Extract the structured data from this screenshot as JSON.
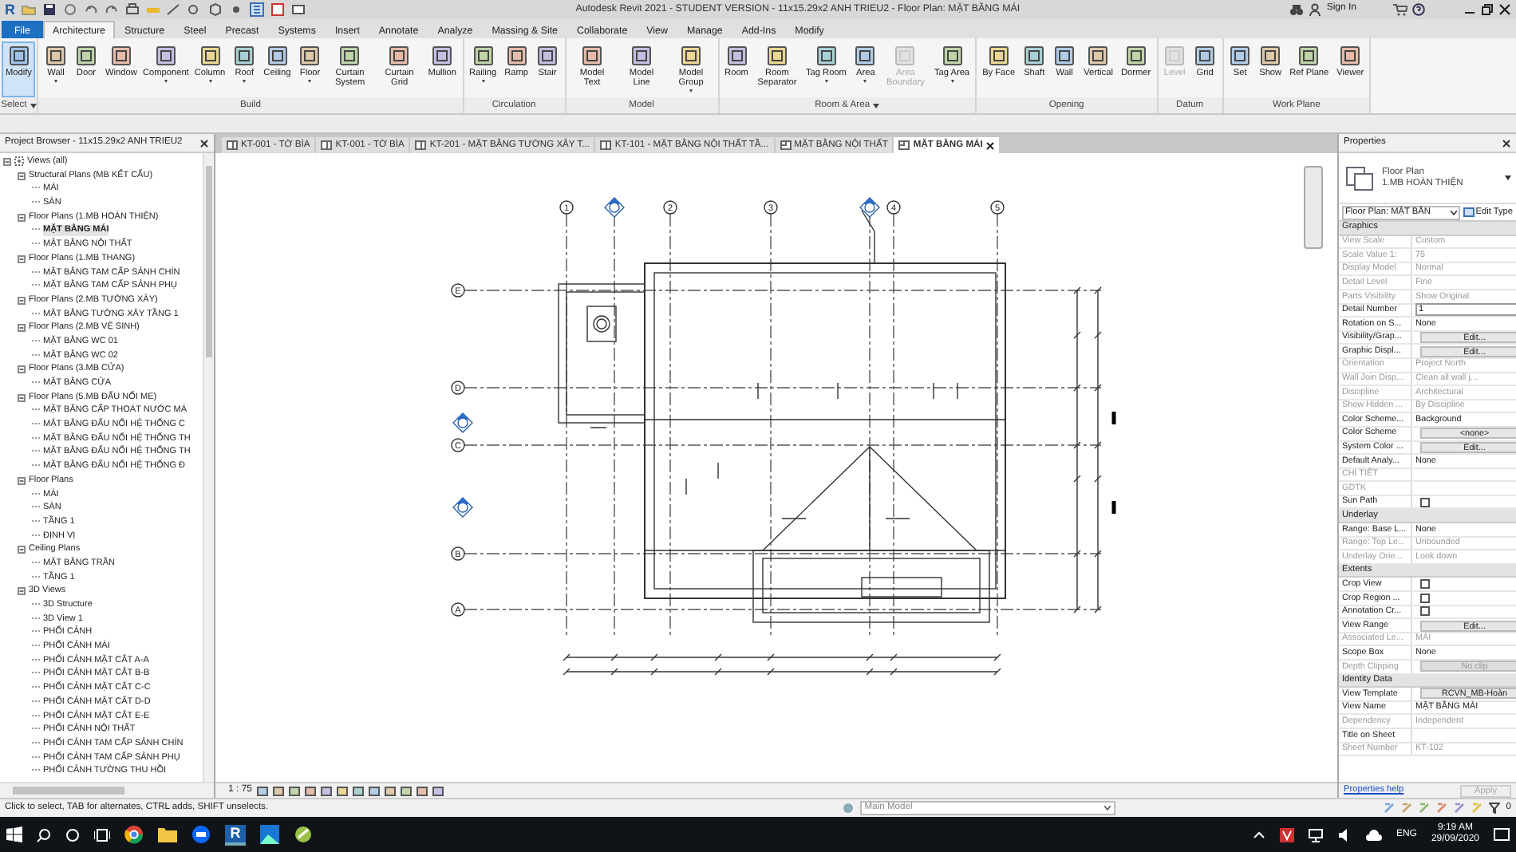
{
  "title_bar": {
    "app_logo": "R",
    "title": "Autodesk Revit 2021 - STUDENT VERSION - 11x15.29x2 ANH TRIEU2 - Floor Plan: MẶT BẰNG MÁI",
    "sign_in": "Sign In"
  },
  "ribbon_tabs": [
    {
      "label": "File",
      "kind": "file",
      "selected": false
    },
    {
      "label": "Architecture",
      "kind": "tab",
      "selected": true
    },
    {
      "label": "Structure",
      "kind": "tab",
      "selected": false
    },
    {
      "label": "Steel",
      "kind": "tab",
      "selected": false
    },
    {
      "label": "Precast",
      "kind": "tab",
      "selected": false
    },
    {
      "label": "Systems",
      "kind": "tab",
      "selected": false
    },
    {
      "label": "Insert",
      "kind": "tab",
      "selected": false
    },
    {
      "label": "Annotate",
      "kind": "tab",
      "selected": false
    },
    {
      "label": "Analyze",
      "kind": "tab",
      "selected": false
    },
    {
      "label": "Massing & Site",
      "kind": "tab",
      "selected": false
    },
    {
      "label": "Collaborate",
      "kind": "tab",
      "selected": false
    },
    {
      "label": "View",
      "kind": "tab",
      "selected": false
    },
    {
      "label": "Manage",
      "kind": "tab",
      "selected": false
    },
    {
      "label": "Add-Ins",
      "kind": "tab",
      "selected": false
    },
    {
      "label": "Modify",
      "kind": "tab",
      "selected": false
    }
  ],
  "ribbon_panels": [
    {
      "label": "Select",
      "has_menu": true,
      "tools": [
        {
          "label": "Modify",
          "selected": true,
          "disabled": false,
          "dropdown": false
        }
      ]
    },
    {
      "label": "Build",
      "has_menu": false,
      "tools": [
        {
          "label": "Wall",
          "selected": false,
          "disabled": false,
          "dropdown": true
        },
        {
          "label": "Door",
          "selected": false,
          "disabled": false,
          "dropdown": false
        },
        {
          "label": "Window",
          "selected": false,
          "disabled": false,
          "dropdown": false
        },
        {
          "label": "Component",
          "selected": false,
          "disabled": false,
          "dropdown": true
        },
        {
          "label": "Column",
          "selected": false,
          "disabled": false,
          "dropdown": true
        },
        {
          "label": "Roof",
          "selected": false,
          "disabled": false,
          "dropdown": true
        },
        {
          "label": "Ceiling",
          "selected": false,
          "disabled": false,
          "dropdown": false
        },
        {
          "label": "Floor",
          "selected": false,
          "disabled": false,
          "dropdown": true
        },
        {
          "label": "Curtain System",
          "selected": false,
          "disabled": false,
          "dropdown": false
        },
        {
          "label": "Curtain Grid",
          "selected": false,
          "disabled": false,
          "dropdown": false
        },
        {
          "label": "Mullion",
          "selected": false,
          "disabled": false,
          "dropdown": false
        }
      ]
    },
    {
      "label": "Circulation",
      "has_menu": false,
      "tools": [
        {
          "label": "Railing",
          "selected": false,
          "disabled": false,
          "dropdown": true
        },
        {
          "label": "Ramp",
          "selected": false,
          "disabled": false,
          "dropdown": false
        },
        {
          "label": "Stair",
          "selected": false,
          "disabled": false,
          "dropdown": false
        }
      ]
    },
    {
      "label": "Model",
      "has_menu": false,
      "tools": [
        {
          "label": "Model Text",
          "selected": false,
          "disabled": false,
          "dropdown": false
        },
        {
          "label": "Model Line",
          "selected": false,
          "disabled": false,
          "dropdown": false
        },
        {
          "label": "Model Group",
          "selected": false,
          "disabled": false,
          "dropdown": true
        }
      ]
    },
    {
      "label": "Room & Area",
      "has_menu": true,
      "tools": [
        {
          "label": "Room",
          "selected": false,
          "disabled": false,
          "dropdown": false
        },
        {
          "label": "Room Separator",
          "selected": false,
          "disabled": false,
          "dropdown": false
        },
        {
          "label": "Tag Room",
          "selected": false,
          "disabled": false,
          "dropdown": true
        },
        {
          "label": "Area",
          "selected": false,
          "disabled": false,
          "dropdown": true
        },
        {
          "label": "Area Boundary",
          "selected": false,
          "disabled": true,
          "dropdown": false
        },
        {
          "label": "Tag Area",
          "selected": false,
          "disabled": false,
          "dropdown": true
        }
      ]
    },
    {
      "label": "Opening",
      "has_menu": false,
      "tools": [
        {
          "label": "By Face",
          "selected": false,
          "disabled": false,
          "dropdown": false
        },
        {
          "label": "Shaft",
          "selected": false,
          "disabled": false,
          "dropdown": false
        },
        {
          "label": "Wall",
          "selected": false,
          "disabled": false,
          "dropdown": false
        },
        {
          "label": "Vertical",
          "selected": false,
          "disabled": false,
          "dropdown": false
        },
        {
          "label": "Dormer",
          "selected": false,
          "disabled": false,
          "dropdown": false
        }
      ]
    },
    {
      "label": "Datum",
      "has_menu": false,
      "tools": [
        {
          "label": "Level",
          "selected": false,
          "disabled": true,
          "dropdown": false
        },
        {
          "label": "Grid",
          "selected": false,
          "disabled": false,
          "dropdown": false
        }
      ]
    },
    {
      "label": "Work Plane",
      "has_menu": false,
      "tools": [
        {
          "label": "Set",
          "selected": false,
          "disabled": false,
          "dropdown": false
        },
        {
          "label": "Show",
          "selected": false,
          "disabled": false,
          "dropdown": false
        },
        {
          "label": "Ref Plane",
          "selected": false,
          "disabled": false,
          "dropdown": false
        },
        {
          "label": "Viewer",
          "selected": false,
          "disabled": false,
          "dropdown": false
        }
      ]
    }
  ],
  "project_browser": {
    "title": "Project Browser - 11x15.29x2 ANH TRIEU2",
    "tree": [
      {
        "label": "Views (all)",
        "selected": false,
        "expanded": true,
        "children": [
          {
            "label": "Structural Plans (MB KẾT CẤU)",
            "selected": false,
            "expanded": true,
            "children": [
              {
                "label": "MÁI",
                "selected": false
              },
              {
                "label": "SÀN",
                "selected": false
              }
            ]
          },
          {
            "label": "Floor Plans (1.MB HOÀN THIỆN)",
            "selected": false,
            "expanded": true,
            "children": [
              {
                "label": "MẶT BẰNG MÁI",
                "selected": true
              },
              {
                "label": "MẶT BẰNG NỘI THẤT",
                "selected": false
              }
            ]
          },
          {
            "label": "Floor Plans (1.MB THANG)",
            "selected": false,
            "expanded": true,
            "children": [
              {
                "label": "MẶT BẰNG TAM CẤP SẢNH CHÍN",
                "selected": false
              },
              {
                "label": "MẶT BẰNG TAM CẤP SẢNH PHỤ",
                "selected": false
              }
            ]
          },
          {
            "label": "Floor Plans (2.MB TƯỜNG XÂY)",
            "selected": false,
            "expanded": true,
            "children": [
              {
                "label": "MẶT BẰNG TƯỜNG XÂY TẦNG 1",
                "selected": false
              }
            ]
          },
          {
            "label": "Floor Plans (2.MB VỆ SINH)",
            "selected": false,
            "expanded": true,
            "children": [
              {
                "label": "MẶT BẰNG WC 01",
                "selected": false
              },
              {
                "label": "MẶT BẰNG WC 02",
                "selected": false
              }
            ]
          },
          {
            "label": "Floor Plans (3.MB CỬA)",
            "selected": false,
            "expanded": true,
            "children": [
              {
                "label": "MẶT BẰNG CỬA",
                "selected": false
              }
            ]
          },
          {
            "label": "Floor Plans (5.MB ĐẤU NỐI ME)",
            "selected": false,
            "expanded": true,
            "children": [
              {
                "label": "MẶT BẰNG CẤP THOÁT NƯỚC MÁ",
                "selected": false
              },
              {
                "label": "MẶT BẰNG ĐẤU NỐI HỆ THỐNG C",
                "selected": false
              },
              {
                "label": "MẶT BẰNG ĐẤU NỐI HỆ THỐNG TH",
                "selected": false
              },
              {
                "label": "MẶT BẰNG ĐẤU NỐI HỆ THỐNG TH",
                "selected": false
              },
              {
                "label": "MẶT BẰNG ĐẤU NỐI HỆ THỐNG Đ",
                "selected": false
              }
            ]
          },
          {
            "label": "Floor Plans",
            "selected": false,
            "expanded": true,
            "children": [
              {
                "label": "MÁI",
                "selected": false
              },
              {
                "label": "SÀN",
                "selected": false
              },
              {
                "label": "TẦNG 1",
                "selected": false
              },
              {
                "label": "ĐỊNH VỊ",
                "selected": false
              }
            ]
          },
          {
            "label": "Ceiling Plans",
            "selected": false,
            "expanded": true,
            "children": [
              {
                "label": "MẶT BẰNG TRẦN",
                "selected": false
              },
              {
                "label": "TẦNG 1",
                "selected": false
              }
            ]
          },
          {
            "label": "3D Views",
            "selected": false,
            "expanded": true,
            "children": [
              {
                "label": "3D Structure",
                "selected": false
              },
              {
                "label": "3D View 1",
                "selected": false
              },
              {
                "label": "PHỐI CẢNH",
                "selected": false
              },
              {
                "label": "PHỐI CẢNH MÁI",
                "selected": false
              },
              {
                "label": "PHỐI CẢNH MẶT CẮT A-A",
                "selected": false
              },
              {
                "label": "PHỐI CẢNH MẶT CẮT B-B",
                "selected": false
              },
              {
                "label": "PHỐI CẢNH MẶT CẮT C-C",
                "selected": false
              },
              {
                "label": "PHỐI CẢNH MẶT CẮT D-D",
                "selected": false
              },
              {
                "label": "PHỐI CẢNH MẶT CẮT E-E",
                "selected": false
              },
              {
                "label": "PHỐI CẢNH NỘI THẤT",
                "selected": false
              },
              {
                "label": "PHỐI CẢNH TAM CẤP SẢNH CHÍN",
                "selected": false
              },
              {
                "label": "PHỐI CẢNH TAM CẤP SẢNH PHỤ",
                "selected": false
              },
              {
                "label": "PHỐI CẢNH TƯỜNG THU HỒI",
                "selected": false
              }
            ]
          }
        ]
      }
    ]
  },
  "view_tabs": [
    {
      "label": "KT-001 - TỜ BÌA",
      "kind": "sheet",
      "selected": false
    },
    {
      "label": "KT-001 - TỜ BÌA",
      "kind": "sheet",
      "selected": false
    },
    {
      "label": "KT-201 - MẶT BẰNG TƯỜNG XÂY T...",
      "kind": "sheet",
      "selected": false
    },
    {
      "label": "KT-101 - MẶT BẰNG NỘI THẤT TẦ...",
      "kind": "sheet",
      "selected": false
    },
    {
      "label": "MẶT BẰNG NỘI THẤT",
      "kind": "plan",
      "selected": false
    },
    {
      "label": "MẶT BẰNG MÁI",
      "kind": "plan",
      "selected": true
    }
  ],
  "drawing": {
    "column_grids": [
      "1",
      "2",
      "3",
      "4",
      "5"
    ],
    "row_grids": [
      "E",
      "D",
      "C",
      "B",
      "A"
    ]
  },
  "view_bar": {
    "scale": "1 : 75"
  },
  "properties": {
    "title": "Properties",
    "type_family": "Floor Plan",
    "type_name": "1.MB HOÀN THIỆN",
    "instance_selector": "Floor Plan: MẶT BẰN",
    "edit_type": "Edit Type",
    "groups": [
      {
        "label": "Graphics",
        "rows": [
          {
            "name": "View Scale",
            "value": "Custom",
            "kind": "text",
            "disabled": true
          },
          {
            "name": "Scale Value    1:",
            "value": "75",
            "kind": "text",
            "disabled": true
          },
          {
            "name": "Display Model",
            "value": "Normal",
            "kind": "text",
            "disabled": true
          },
          {
            "name": "Detail Level",
            "value": "Fine",
            "kind": "text",
            "disabled": true
          },
          {
            "name": "Parts Visibility",
            "value": "Show Original",
            "kind": "text",
            "disabled": true
          },
          {
            "name": "Detail Number",
            "value": "1",
            "kind": "input",
            "disabled": false
          },
          {
            "name": "Rotation on S...",
            "value": "None",
            "kind": "text",
            "disabled": false
          },
          {
            "name": "Visibility/Grap...",
            "value": "Edit...",
            "kind": "button",
            "disabled": false
          },
          {
            "name": "Graphic Displ...",
            "value": "Edit...",
            "kind": "button",
            "disabled": false
          },
          {
            "name": "Orientation",
            "value": "Project North",
            "kind": "text",
            "disabled": true
          },
          {
            "name": "Wall Join Disp...",
            "value": "Clean all wall j...",
            "kind": "text",
            "disabled": true
          },
          {
            "name": "Discipline",
            "value": "Architectural",
            "kind": "text",
            "disabled": true
          },
          {
            "name": "Show Hidden ...",
            "value": "By Discipline",
            "kind": "text",
            "disabled": true
          },
          {
            "name": "Color Scheme...",
            "value": "Background",
            "kind": "text",
            "disabled": false
          },
          {
            "name": "Color Scheme",
            "value": "<none>",
            "kind": "button",
            "disabled": false
          },
          {
            "name": "System Color ...",
            "value": "Edit...",
            "kind": "button",
            "disabled": false
          },
          {
            "name": "Default Analy...",
            "value": "None",
            "kind": "text",
            "disabled": false
          },
          {
            "name": "CHI TIẾT",
            "kind": "text",
            "disabled": true
          },
          {
            "name": "GDTK",
            "kind": "text",
            "disabled": true
          },
          {
            "name": "Sun Path",
            "kind": "checkbox",
            "checked": false,
            "disabled": false
          }
        ]
      },
      {
        "label": "Underlay",
        "rows": [
          {
            "name": "Range: Base L...",
            "value": "None",
            "kind": "text",
            "disabled": false
          },
          {
            "name": "Range: Top Le...",
            "value": "Unbounded",
            "kind": "text",
            "disabled": true
          },
          {
            "name": "Underlay Orie...",
            "value": "Look down",
            "kind": "text",
            "disabled": true
          }
        ]
      },
      {
        "label": "Extents",
        "rows": [
          {
            "name": "Crop View",
            "kind": "checkbox",
            "checked": false,
            "disabled": false
          },
          {
            "name": "Crop Region ...",
            "kind": "checkbox",
            "checked": false,
            "disabled": false
          },
          {
            "name": "Annotation Cr...",
            "kind": "checkbox",
            "checked": false,
            "disabled": false
          },
          {
            "name": "View Range",
            "value": "Edit...",
            "kind": "button",
            "disabled": false
          },
          {
            "name": "Associated Le...",
            "value": "MÁI",
            "kind": "text",
            "disabled": true
          },
          {
            "name": "Scope Box",
            "value": "None",
            "kind": "text",
            "disabled": false
          },
          {
            "name": "Depth Clipping",
            "value": "No clip",
            "kind": "button",
            "disabled": true
          }
        ]
      },
      {
        "label": "Identity Data",
        "rows": [
          {
            "name": "View Template",
            "value": "RCVN_MB-Hoàn",
            "kind": "button",
            "disabled": false
          },
          {
            "name": "View Name",
            "value": "MẶT BẰNG MÁI",
            "kind": "text",
            "disabled": false
          },
          {
            "name": "Dependency",
            "value": "Independent",
            "kind": "text",
            "disabled": true
          },
          {
            "name": "Title on Sheet",
            "kind": "text",
            "disabled": false
          },
          {
            "name": "Sheet Number",
            "value": "KT-102",
            "kind": "text",
            "disabled": true
          }
        ]
      }
    ],
    "help_link": "Properties help",
    "apply": {
      "label": "Apply",
      "disabled": true
    }
  },
  "status_bar": {
    "message": "Click to select, TAB for alternates, CTRL adds, SHIFT unselects.",
    "model": "Main Model",
    "filter_count": "0"
  },
  "taskbar": {
    "revit_label": "R",
    "language": "ENG",
    "time": "9:19 AM",
    "date": "29/09/2020"
  }
}
